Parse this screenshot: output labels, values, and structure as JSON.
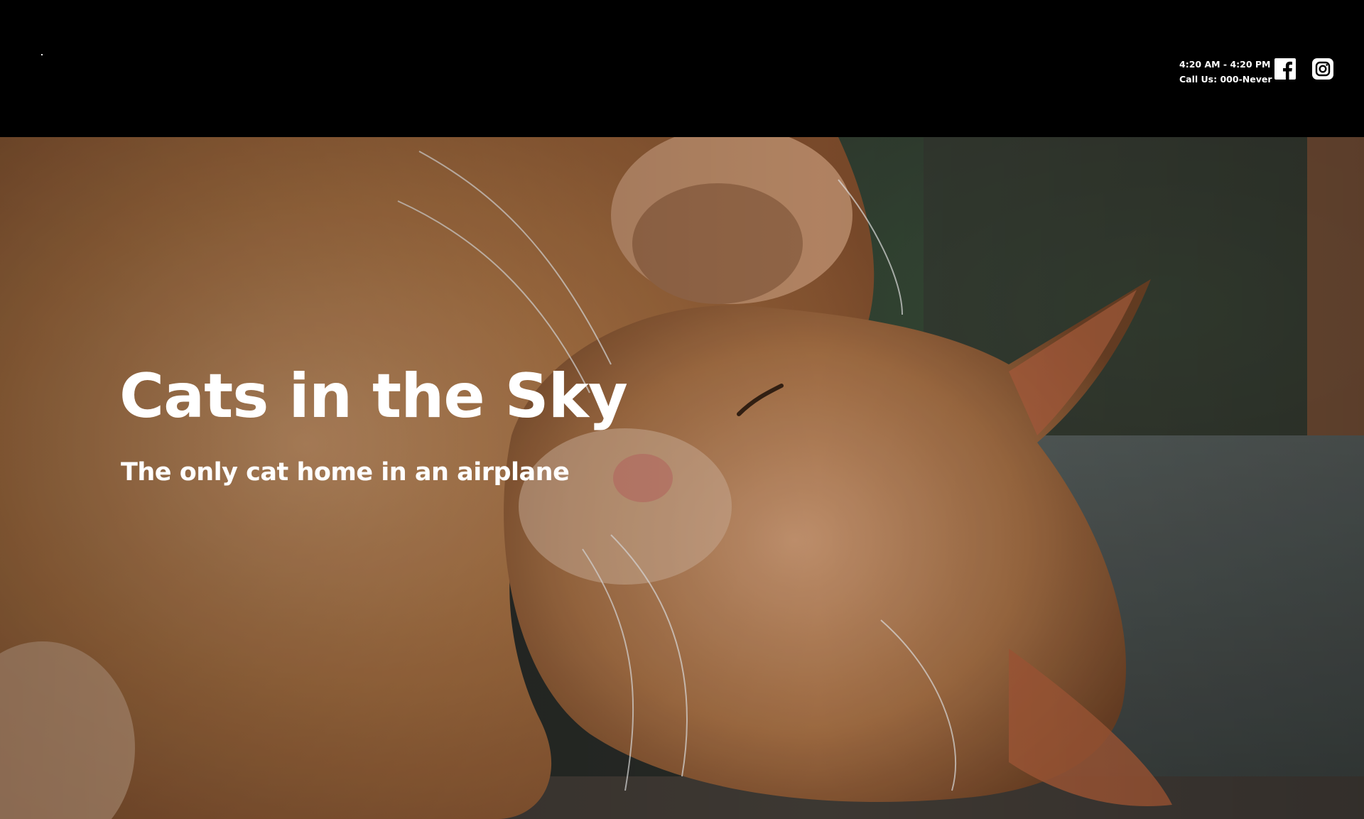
{
  "header": {
    "hours": "4:20 AM - 4:20 PM",
    "phone": "Call Us: 000-Never",
    "social": [
      {
        "name": "facebook-icon"
      },
      {
        "name": "instagram-icon"
      }
    ]
  },
  "hero": {
    "title": "Cats in the Sky",
    "subtitle": "The only cat home in an airplane"
  },
  "colors": {
    "header_bg": "#000000",
    "text": "#ffffff",
    "fur_orange": "#c58850",
    "background_green": "#4a5a48"
  }
}
